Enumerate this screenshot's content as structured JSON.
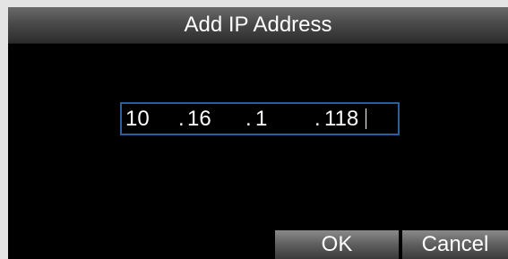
{
  "dialog": {
    "title": "Add IP Address"
  },
  "ip_address": {
    "octet1": "10",
    "octet2": "16",
    "octet3": "1",
    "octet4": "118",
    "separator": "."
  },
  "buttons": {
    "ok_label": "OK",
    "cancel_label": "Cancel"
  },
  "colors": {
    "field_border": "#2a5f9a",
    "background": "#000000",
    "text": "#ffffff"
  }
}
